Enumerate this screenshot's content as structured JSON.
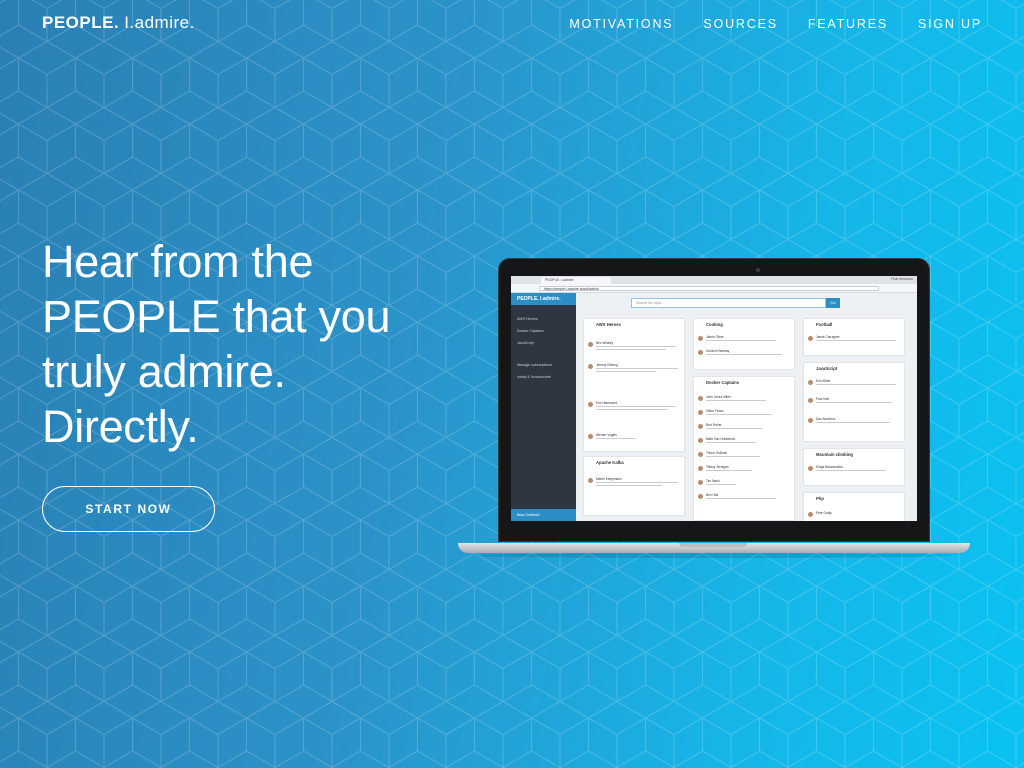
{
  "brand": {
    "bold": "PEOPLE.",
    "light": "I.admire."
  },
  "nav": [
    {
      "label": "MOTIVATIONS"
    },
    {
      "label": "SOURCES"
    },
    {
      "label": "FEATURES"
    },
    {
      "label": "SIGN UP"
    }
  ],
  "hero": {
    "lines": [
      "Hear from the",
      "PEOPLE that you",
      "truly admire.",
      "Directly."
    ],
    "cta": "START NOW"
  },
  "screen": {
    "tab_title": "PEOPLE. I.admire",
    "user": "Piotr Antoniou",
    "url": "https://people-i-admire.cloud/admin",
    "sidebar": {
      "logo": "PEOPLE. I.admire.",
      "items": [
        "AWS Heroes",
        "Docker Captains",
        "JavaScript",
        "Manage subscriptions",
        "Install & Unsubscribe"
      ],
      "footer": "Brian Dubinski"
    },
    "search_placeholder": "Search for topic...",
    "search_button": "Go!",
    "cards": [
      {
        "title": "AWS Heroes",
        "people": [
          "Ben Whaley",
          "Jeremy Edberg",
          "Eric Hammond",
          "Werner Vogels"
        ]
      },
      {
        "title": "Apache Kafka",
        "people": [
          "Martin Kleppmann"
        ]
      },
      {
        "title": "Cooking",
        "people": [
          "Jamie Oliver",
          "Gordon Ramsay"
        ]
      },
      {
        "title": "Docker Captains",
        "people": [
          "John Jones Miller",
          "Viktor Farcic",
          "Bret Fisher",
          "Mark Van Holsbeeck",
          "Trevor Sullivan",
          "Tiffany Jernigan",
          "Tim Nash",
          "Ben Hall"
        ]
      },
      {
        "title": "Football",
        "people": [
          "Jamie Carragher"
        ]
      },
      {
        "title": "JavaScript",
        "people": [
          "Eric Elliott",
          "Paul Irish",
          "Dan Abramov"
        ]
      },
      {
        "title": "Mountain climbing",
        "people": [
          "Kinga Baranowska"
        ]
      },
      {
        "title": "Php",
        "people": [
          "Pete Gobly"
        ]
      }
    ]
  },
  "colors": {
    "accent": "#2b8fc5",
    "bg_left": "#2a7fb3",
    "bg_right": "#09c2f2"
  }
}
